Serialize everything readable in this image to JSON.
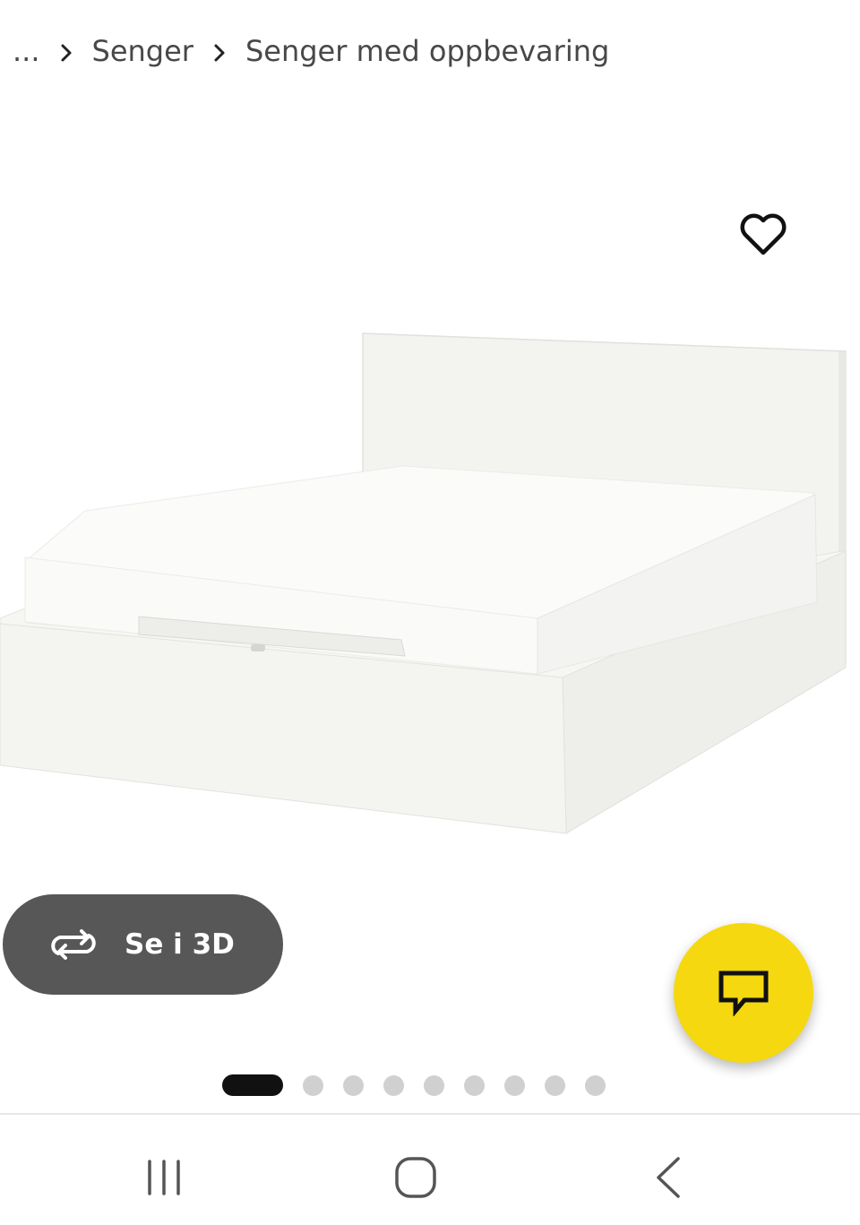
{
  "breadcrumb": {
    "ellipsis": "...",
    "items": [
      "Senger",
      "Senger med oppbevaring"
    ]
  },
  "product": {
    "view_3d_label": "Se i 3D",
    "image_count": 9,
    "active_image_index": 0
  },
  "icons": {
    "favorite": "heart-outline-icon",
    "rotate_3d": "rotate-3d-icon",
    "chat": "chat-bubble-icon",
    "breadcrumb_separator": "chevron-right-icon",
    "nav_recents": "recents-icon",
    "nav_home": "home-icon",
    "nav_back": "back-icon"
  },
  "colors": {
    "chat_fab": "#f5d80f",
    "view_3d_button": "#575757",
    "dot_active": "#111111",
    "dot_inactive": "#d0d0d0"
  }
}
